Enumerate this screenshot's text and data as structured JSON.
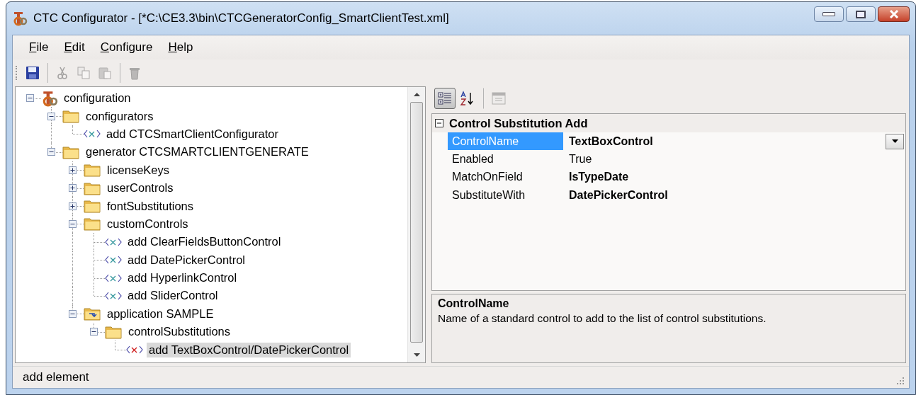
{
  "window": {
    "title": "CTC Configurator - [*C:\\CE3.3\\bin\\CTCGeneratorConfig_SmartClientTest.xml]"
  },
  "menu": [
    {
      "label": "File"
    },
    {
      "label": "Edit"
    },
    {
      "label": "Configure"
    },
    {
      "label": "Help"
    }
  ],
  "toolbar": [
    {
      "kind": "save",
      "disabled": false,
      "separator_before": false
    },
    {
      "kind": "cut",
      "disabled": true,
      "separator_before": true
    },
    {
      "kind": "copy",
      "disabled": true,
      "separator_before": false
    },
    {
      "kind": "paste",
      "disabled": true,
      "separator_before": false
    },
    {
      "kind": "delete",
      "disabled": true,
      "separator_before": true
    }
  ],
  "tree": [
    {
      "label": "configuration",
      "kind": "root",
      "expanded": true,
      "selected": false,
      "children": [
        {
          "label": "configurators",
          "kind": "folder",
          "expanded": true,
          "selected": false,
          "children": [
            {
              "label": "add CTCSmartClientConfigurator",
              "kind": "element",
              "selected": false
            }
          ]
        },
        {
          "label": "generator CTCSMARTCLIENTGENERATE",
          "kind": "folder",
          "expanded": true,
          "selected": false,
          "children": [
            {
              "label": "licenseKeys",
              "kind": "folder",
              "expanded": false,
              "selected": false
            },
            {
              "label": "userControls",
              "kind": "folder",
              "expanded": false,
              "selected": false
            },
            {
              "label": "fontSubstitutions",
              "kind": "folder",
              "expanded": false,
              "selected": false
            },
            {
              "label": "customControls",
              "kind": "folder",
              "expanded": true,
              "selected": false,
              "children": [
                {
                  "label": "add ClearFieldsButtonControl",
                  "kind": "element",
                  "selected": false
                },
                {
                  "label": "add DatePickerControl",
                  "kind": "element",
                  "selected": false
                },
                {
                  "label": "add HyperlinkControl",
                  "kind": "element",
                  "selected": false
                },
                {
                  "label": "add SliderControl",
                  "kind": "element",
                  "selected": false
                }
              ]
            },
            {
              "label": "application SAMPLE",
              "kind": "app-folder",
              "expanded": true,
              "selected": false,
              "children": [
                {
                  "label": "controlSubstitutions",
                  "kind": "folder",
                  "expanded": true,
                  "selected": false,
                  "children": [
                    {
                      "label": "add TextBoxControl/DatePickerControl",
                      "kind": "element",
                      "selected": true
                    }
                  ]
                }
              ]
            }
          ]
        }
      ]
    }
  ],
  "property_toolbar": [
    {
      "kind": "categorized",
      "selected": true,
      "disabled": false,
      "separator_before": false
    },
    {
      "kind": "alphabetical",
      "selected": false,
      "disabled": false,
      "separator_before": false
    },
    {
      "kind": "property-pages",
      "selected": false,
      "disabled": true,
      "separator_before": true
    }
  ],
  "property_grid": {
    "category": {
      "label": "Control Substitution Add",
      "expanded": true
    },
    "properties": [
      {
        "name": "ControlName",
        "value": "TextBoxControl",
        "modified": true,
        "selected": true
      },
      {
        "name": "Enabled",
        "value": "True",
        "modified": false,
        "selected": false
      },
      {
        "name": "MatchOnField",
        "value": "IsTypeDate",
        "modified": true,
        "selected": false
      },
      {
        "name": "SubstituteWith",
        "value": "DatePickerControl",
        "modified": true,
        "selected": false
      }
    ]
  },
  "help": {
    "title": "ControlName",
    "description": "Name of a standard control to add to the list of control substitutions."
  },
  "status_bar": {
    "text": "add element"
  }
}
